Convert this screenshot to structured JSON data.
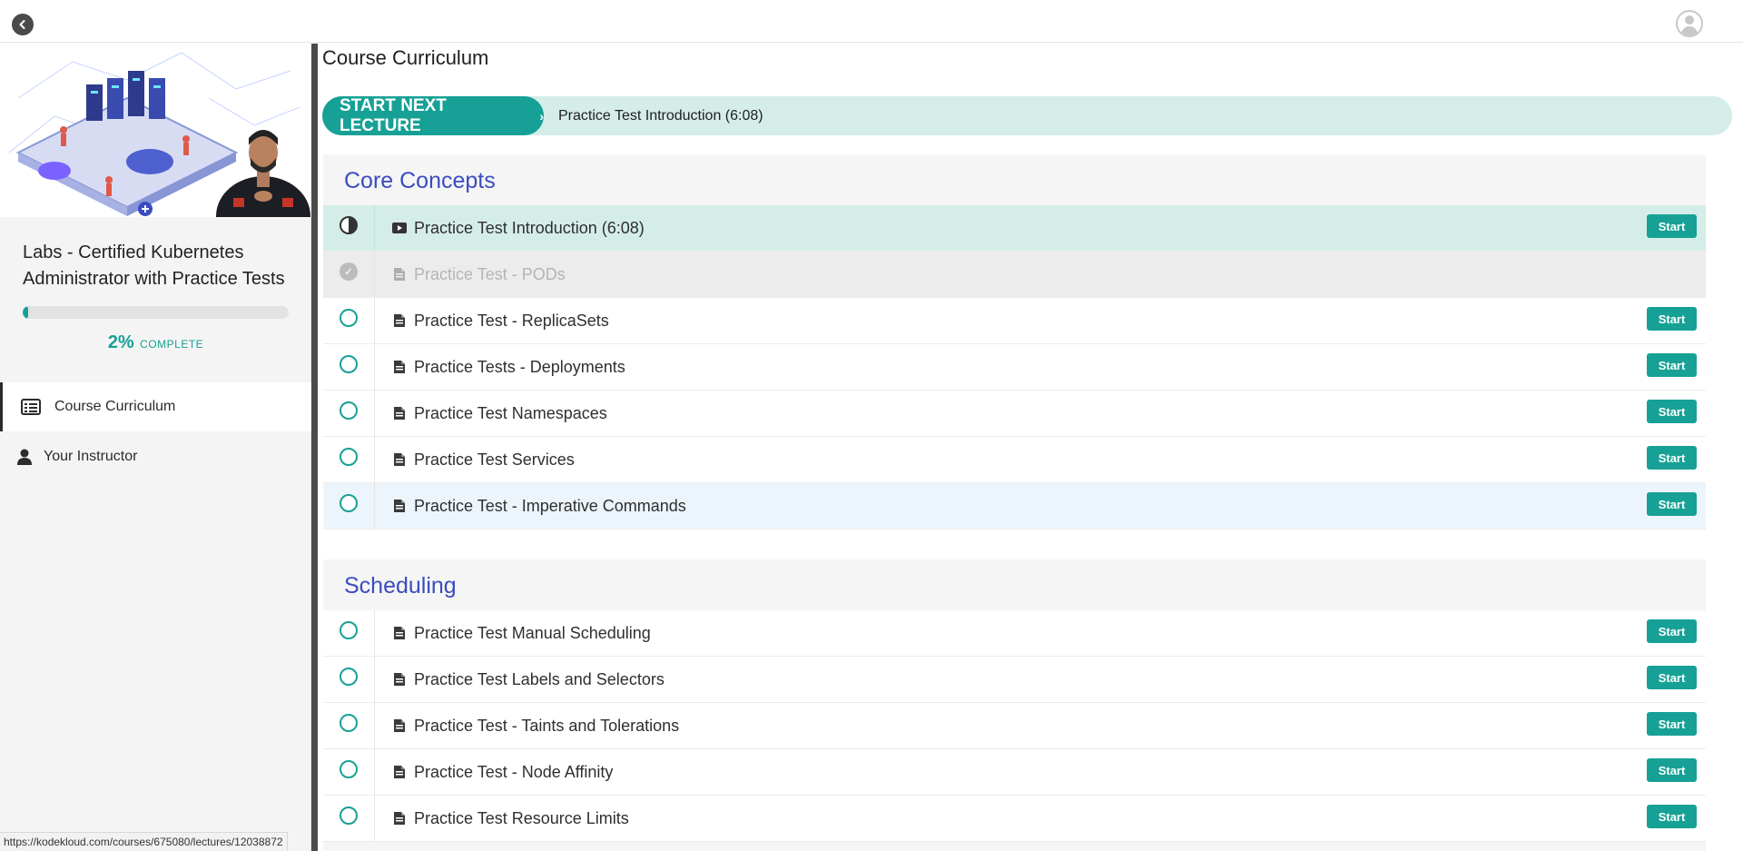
{
  "sidebar": {
    "course_title": "Labs - Certified Kubernetes Administrator with Practice Tests",
    "progress": {
      "percent_value": 2,
      "percent": "2%",
      "label": "COMPLETE"
    },
    "nav": [
      {
        "label": "Course Curriculum",
        "icon": "list-icon",
        "active": true
      },
      {
        "label": "Your Instructor",
        "icon": "person-icon",
        "active": false
      }
    ]
  },
  "main": {
    "heading": "Course Curriculum",
    "next_lecture": {
      "button_label": "START NEXT LECTURE",
      "chevron": "›",
      "title": "Practice Test Introduction (6:08)"
    },
    "sections": [
      {
        "title": "Core Concepts",
        "lectures": [
          {
            "name": "Practice Test Introduction (6:08)",
            "icon": "video-icon",
            "status": "in-progress",
            "state": "current",
            "action": "Start"
          },
          {
            "name": "Practice Test - PODs",
            "icon": "document-icon",
            "status": "completed",
            "state": "completed",
            "action": ""
          },
          {
            "name": "Practice Test - ReplicaSets",
            "icon": "document-icon",
            "status": "not-started",
            "state": "",
            "action": "Start"
          },
          {
            "name": "Practice Tests - Deployments",
            "icon": "document-icon",
            "status": "not-started",
            "state": "",
            "action": "Start"
          },
          {
            "name": "Practice Test Namespaces",
            "icon": "document-icon",
            "status": "not-started",
            "state": "",
            "action": "Start"
          },
          {
            "name": "Practice Test Services",
            "icon": "document-icon",
            "status": "not-started",
            "state": "",
            "action": "Start"
          },
          {
            "name": "Practice Test - Imperative Commands",
            "icon": "document-icon",
            "status": "not-started",
            "state": "hover",
            "action": "Start"
          }
        ]
      },
      {
        "title": "Scheduling",
        "lectures": [
          {
            "name": "Practice Test Manual Scheduling",
            "icon": "document-icon",
            "status": "not-started",
            "state": "",
            "action": "Start"
          },
          {
            "name": "Practice Test Labels and Selectors",
            "icon": "document-icon",
            "status": "not-started",
            "state": "",
            "action": "Start"
          },
          {
            "name": "Practice Test - Taints and Tolerations",
            "icon": "document-icon",
            "status": "not-started",
            "state": "",
            "action": "Start"
          },
          {
            "name": "Practice Test - Node Affinity",
            "icon": "document-icon",
            "status": "not-started",
            "state": "",
            "action": "Start"
          },
          {
            "name": "Practice Test Resource Limits",
            "icon": "document-icon",
            "status": "not-started",
            "state": "",
            "action": "Start"
          }
        ]
      }
    ]
  },
  "statusbar": {
    "url": "https://kodekloud.com/courses/675080/lectures/12038872"
  },
  "colors": {
    "accent": "#17a196",
    "section_title": "#3b4cc0",
    "current_row": "#d4ede9"
  }
}
